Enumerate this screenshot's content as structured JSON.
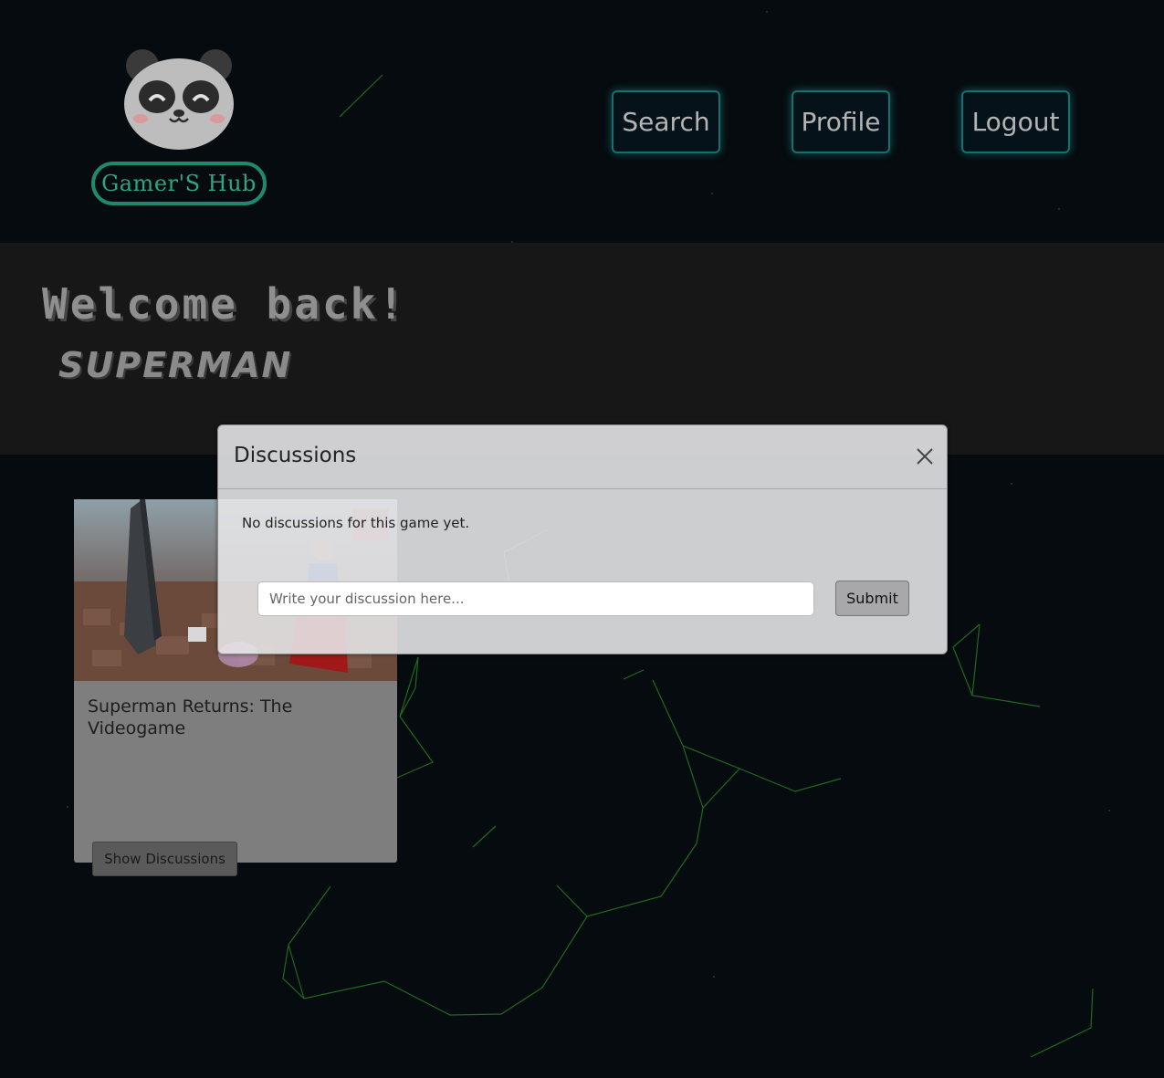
{
  "header": {
    "logo_text": "Gamer'S Hub",
    "nav": {
      "search_label": "Search",
      "profile_label": "Profile",
      "logout_label": "Logout"
    }
  },
  "welcome": {
    "title": "Welcome back!",
    "username": "SUPERMAN"
  },
  "game_card": {
    "title": "Superman Returns: The Videogame",
    "show_discussions_label": "Show Discussions"
  },
  "modal": {
    "title": "Discussions",
    "empty_message": "No discussions for this game yet.",
    "input_placeholder": "Write your discussion here...",
    "input_value": "",
    "submit_label": "Submit"
  },
  "colors": {
    "background": "#050b0f",
    "nav_border": "#157070",
    "logo_green": "#2fa583",
    "network_lines": "#1f7a1f"
  },
  "icons": [
    "panda-logo-icon",
    "close-icon"
  ]
}
